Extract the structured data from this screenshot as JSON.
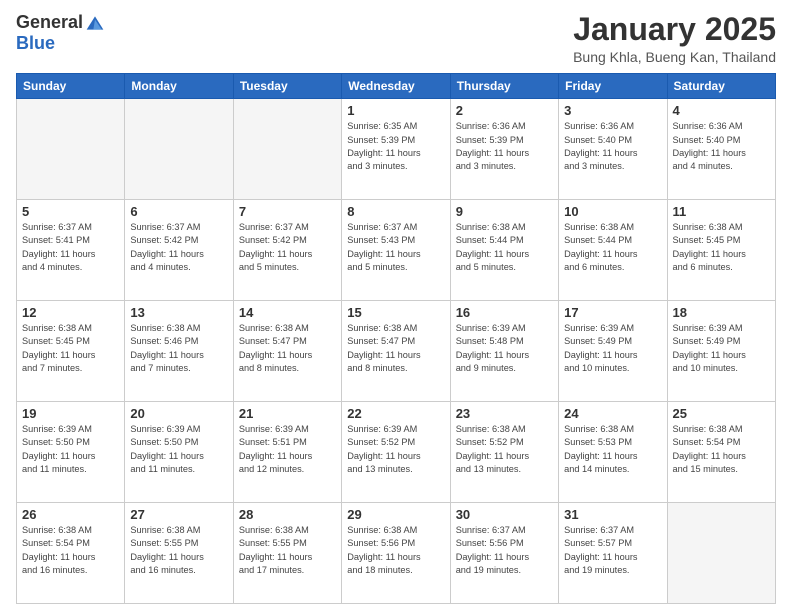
{
  "header": {
    "logo_general": "General",
    "logo_blue": "Blue",
    "month_title": "January 2025",
    "location": "Bung Khla, Bueng Kan, Thailand"
  },
  "weekdays": [
    "Sunday",
    "Monday",
    "Tuesday",
    "Wednesday",
    "Thursday",
    "Friday",
    "Saturday"
  ],
  "weeks": [
    [
      {
        "day": "",
        "info": ""
      },
      {
        "day": "",
        "info": ""
      },
      {
        "day": "",
        "info": ""
      },
      {
        "day": "1",
        "info": "Sunrise: 6:35 AM\nSunset: 5:39 PM\nDaylight: 11 hours\nand 3 minutes."
      },
      {
        "day": "2",
        "info": "Sunrise: 6:36 AM\nSunset: 5:39 PM\nDaylight: 11 hours\nand 3 minutes."
      },
      {
        "day": "3",
        "info": "Sunrise: 6:36 AM\nSunset: 5:40 PM\nDaylight: 11 hours\nand 3 minutes."
      },
      {
        "day": "4",
        "info": "Sunrise: 6:36 AM\nSunset: 5:40 PM\nDaylight: 11 hours\nand 4 minutes."
      }
    ],
    [
      {
        "day": "5",
        "info": "Sunrise: 6:37 AM\nSunset: 5:41 PM\nDaylight: 11 hours\nand 4 minutes."
      },
      {
        "day": "6",
        "info": "Sunrise: 6:37 AM\nSunset: 5:42 PM\nDaylight: 11 hours\nand 4 minutes."
      },
      {
        "day": "7",
        "info": "Sunrise: 6:37 AM\nSunset: 5:42 PM\nDaylight: 11 hours\nand 5 minutes."
      },
      {
        "day": "8",
        "info": "Sunrise: 6:37 AM\nSunset: 5:43 PM\nDaylight: 11 hours\nand 5 minutes."
      },
      {
        "day": "9",
        "info": "Sunrise: 6:38 AM\nSunset: 5:44 PM\nDaylight: 11 hours\nand 5 minutes."
      },
      {
        "day": "10",
        "info": "Sunrise: 6:38 AM\nSunset: 5:44 PM\nDaylight: 11 hours\nand 6 minutes."
      },
      {
        "day": "11",
        "info": "Sunrise: 6:38 AM\nSunset: 5:45 PM\nDaylight: 11 hours\nand 6 minutes."
      }
    ],
    [
      {
        "day": "12",
        "info": "Sunrise: 6:38 AM\nSunset: 5:45 PM\nDaylight: 11 hours\nand 7 minutes."
      },
      {
        "day": "13",
        "info": "Sunrise: 6:38 AM\nSunset: 5:46 PM\nDaylight: 11 hours\nand 7 minutes."
      },
      {
        "day": "14",
        "info": "Sunrise: 6:38 AM\nSunset: 5:47 PM\nDaylight: 11 hours\nand 8 minutes."
      },
      {
        "day": "15",
        "info": "Sunrise: 6:38 AM\nSunset: 5:47 PM\nDaylight: 11 hours\nand 8 minutes."
      },
      {
        "day": "16",
        "info": "Sunrise: 6:39 AM\nSunset: 5:48 PM\nDaylight: 11 hours\nand 9 minutes."
      },
      {
        "day": "17",
        "info": "Sunrise: 6:39 AM\nSunset: 5:49 PM\nDaylight: 11 hours\nand 10 minutes."
      },
      {
        "day": "18",
        "info": "Sunrise: 6:39 AM\nSunset: 5:49 PM\nDaylight: 11 hours\nand 10 minutes."
      }
    ],
    [
      {
        "day": "19",
        "info": "Sunrise: 6:39 AM\nSunset: 5:50 PM\nDaylight: 11 hours\nand 11 minutes."
      },
      {
        "day": "20",
        "info": "Sunrise: 6:39 AM\nSunset: 5:50 PM\nDaylight: 11 hours\nand 11 minutes."
      },
      {
        "day": "21",
        "info": "Sunrise: 6:39 AM\nSunset: 5:51 PM\nDaylight: 11 hours\nand 12 minutes."
      },
      {
        "day": "22",
        "info": "Sunrise: 6:39 AM\nSunset: 5:52 PM\nDaylight: 11 hours\nand 13 minutes."
      },
      {
        "day": "23",
        "info": "Sunrise: 6:38 AM\nSunset: 5:52 PM\nDaylight: 11 hours\nand 13 minutes."
      },
      {
        "day": "24",
        "info": "Sunrise: 6:38 AM\nSunset: 5:53 PM\nDaylight: 11 hours\nand 14 minutes."
      },
      {
        "day": "25",
        "info": "Sunrise: 6:38 AM\nSunset: 5:54 PM\nDaylight: 11 hours\nand 15 minutes."
      }
    ],
    [
      {
        "day": "26",
        "info": "Sunrise: 6:38 AM\nSunset: 5:54 PM\nDaylight: 11 hours\nand 16 minutes."
      },
      {
        "day": "27",
        "info": "Sunrise: 6:38 AM\nSunset: 5:55 PM\nDaylight: 11 hours\nand 16 minutes."
      },
      {
        "day": "28",
        "info": "Sunrise: 6:38 AM\nSunset: 5:55 PM\nDaylight: 11 hours\nand 17 minutes."
      },
      {
        "day": "29",
        "info": "Sunrise: 6:38 AM\nSunset: 5:56 PM\nDaylight: 11 hours\nand 18 minutes."
      },
      {
        "day": "30",
        "info": "Sunrise: 6:37 AM\nSunset: 5:56 PM\nDaylight: 11 hours\nand 19 minutes."
      },
      {
        "day": "31",
        "info": "Sunrise: 6:37 AM\nSunset: 5:57 PM\nDaylight: 11 hours\nand 19 minutes."
      },
      {
        "day": "",
        "info": ""
      }
    ]
  ]
}
